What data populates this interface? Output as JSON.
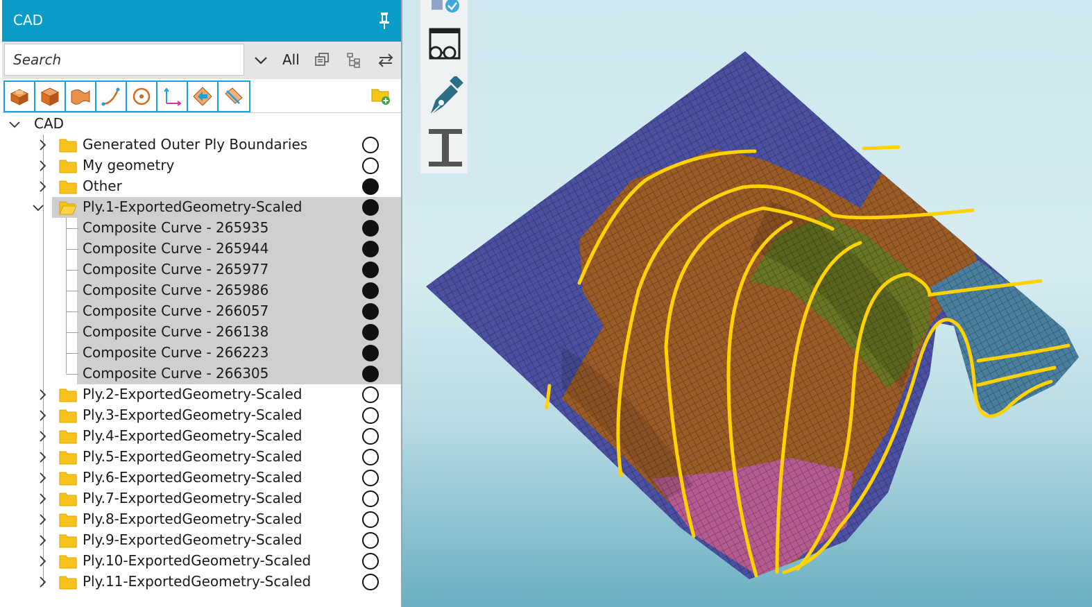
{
  "panel": {
    "title": "CAD",
    "search": {
      "placeholder": "Search",
      "value": ""
    },
    "filter_label": "All",
    "toolbar_icons": [
      "solid-icon",
      "cube-icon",
      "surface-icon",
      "curve-icon",
      "point-icon",
      "axis-system-icon",
      "direction-icon",
      "plane-icon"
    ],
    "tree": {
      "root_label": "CAD",
      "items": [
        {
          "label": "Generated Outer Ply Boundaries",
          "visible": false
        },
        {
          "label": "My geometry",
          "visible": false
        },
        {
          "label": "Other",
          "visible": true
        },
        {
          "label": "Ply.1-ExportedGeometry-Scaled",
          "visible": true,
          "expanded": true
        },
        {
          "label": "Composite Curve - 265935",
          "visible": true
        },
        {
          "label": "Composite Curve - 265944",
          "visible": true
        },
        {
          "label": "Composite Curve - 265977",
          "visible": true
        },
        {
          "label": "Composite Curve - 265986",
          "visible": true
        },
        {
          "label": "Composite Curve - 266057",
          "visible": true
        },
        {
          "label": "Composite Curve - 266138",
          "visible": true
        },
        {
          "label": "Composite Curve - 266223",
          "visible": true
        },
        {
          "label": "Composite Curve - 266305",
          "visible": true
        },
        {
          "label": "Ply.2-ExportedGeometry-Scaled",
          "visible": false
        },
        {
          "label": "Ply.3-ExportedGeometry-Scaled",
          "visible": false
        },
        {
          "label": "Ply.4-ExportedGeometry-Scaled",
          "visible": false
        },
        {
          "label": "Ply.5-ExportedGeometry-Scaled",
          "visible": false
        },
        {
          "label": "Ply.6-ExportedGeometry-Scaled",
          "visible": false
        },
        {
          "label": "Ply.7-ExportedGeometry-Scaled",
          "visible": false
        },
        {
          "label": "Ply.8-ExportedGeometry-Scaled",
          "visible": false
        },
        {
          "label": "Ply.9-ExportedGeometry-Scaled",
          "visible": false
        },
        {
          "label": "Ply.10-ExportedGeometry-Scaled",
          "visible": false
        },
        {
          "label": "Ply.11-ExportedGeometry-Scaled",
          "visible": false
        }
      ]
    }
  },
  "viewport": {
    "side_toolbar_icons": [
      "check-tool-icon",
      "review-glasses-icon",
      "pen-icon",
      "i-beam-icon"
    ],
    "colors": {
      "blue_zone": "#4a4fa0",
      "brown_zone": "#9a5b27",
      "olive_zone": "#6a7523",
      "steel_blue_zone": "#4a7fa0",
      "pink_zone": "#b55a8e",
      "curves": "#ffd200",
      "panel_accent": "#0a9cc7"
    }
  }
}
